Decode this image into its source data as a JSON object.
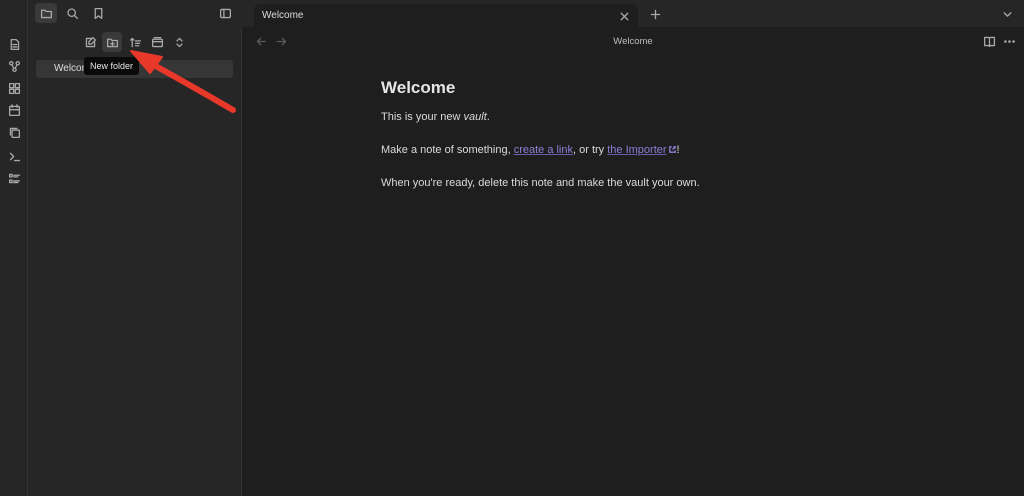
{
  "ribbon": {
    "icons": [
      "file-icon",
      "graph-icon",
      "grid-icon",
      "calendar-icon",
      "copy-icon",
      "terminal-icon",
      "list-icon"
    ]
  },
  "top_left": {
    "icons": [
      "folder-icon",
      "search-icon",
      "bookmark-icon",
      "sidebar-toggle-icon"
    ]
  },
  "file_nav": {
    "icons": [
      "new-note-icon",
      "new-folder-icon",
      "sort-icon",
      "collapse-icon",
      "expand-icon"
    ],
    "tooltip": "New folder",
    "file_label": "Welcome"
  },
  "tabs": {
    "active_label": "Welcome"
  },
  "view": {
    "title": "Welcome"
  },
  "note": {
    "heading": "Welcome",
    "line1_prefix": "This is your new ",
    "line1_emph": "vault",
    "line1_suffix": ".",
    "line2_prefix": "Make a note of something, ",
    "line2_link1": "create a link",
    "line2_middle": ", or try ",
    "line2_link2": "the Importer",
    "line2_suffix": "!",
    "line3": "When you're ready, delete this note and make the vault your own."
  },
  "colors": {
    "accent_link": "#8f7fd6",
    "annotation_arrow": "#e8382a"
  }
}
